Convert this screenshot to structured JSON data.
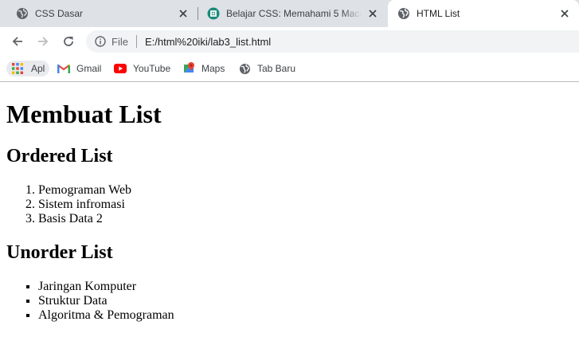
{
  "browser": {
    "tabs": [
      {
        "title": "CSS Dasar",
        "icon": "globe-icon",
        "active": false
      },
      {
        "title": "Belajar CSS: Memahami 5 Macam",
        "icon": "site-favicon",
        "active": false
      },
      {
        "title": "HTML List",
        "icon": "globe-icon",
        "active": true
      }
    ],
    "toolbar": {
      "scheme_label": "File",
      "url": "E:/html%20iki/lab3_list.html"
    },
    "bookmarks": [
      {
        "label": "Apl",
        "icon": "apps-grid-icon"
      },
      {
        "label": "Gmail",
        "icon": "gmail-icon"
      },
      {
        "label": "YouTube",
        "icon": "youtube-icon"
      },
      {
        "label": "Maps",
        "icon": "maps-icon"
      },
      {
        "label": "Tab Baru",
        "icon": "globe-icon"
      }
    ]
  },
  "page": {
    "heading": "Membuat List",
    "ordered": {
      "heading": "Ordered List",
      "items": [
        "Pemograman Web",
        "Sistem infromasi",
        "Basis Data 2"
      ]
    },
    "unordered": {
      "heading": "Unorder List",
      "items": [
        "Jaringan Komputer",
        "Struktur Data",
        "Algoritma & Pemograman"
      ]
    }
  },
  "colors": {
    "tabstrip_bg": "#dee1e6",
    "omnibox_bg": "#f1f3f4",
    "text_primary": "#202124",
    "youtube_red": "#ff0000",
    "favicon_teal": "#1a8a7a"
  }
}
